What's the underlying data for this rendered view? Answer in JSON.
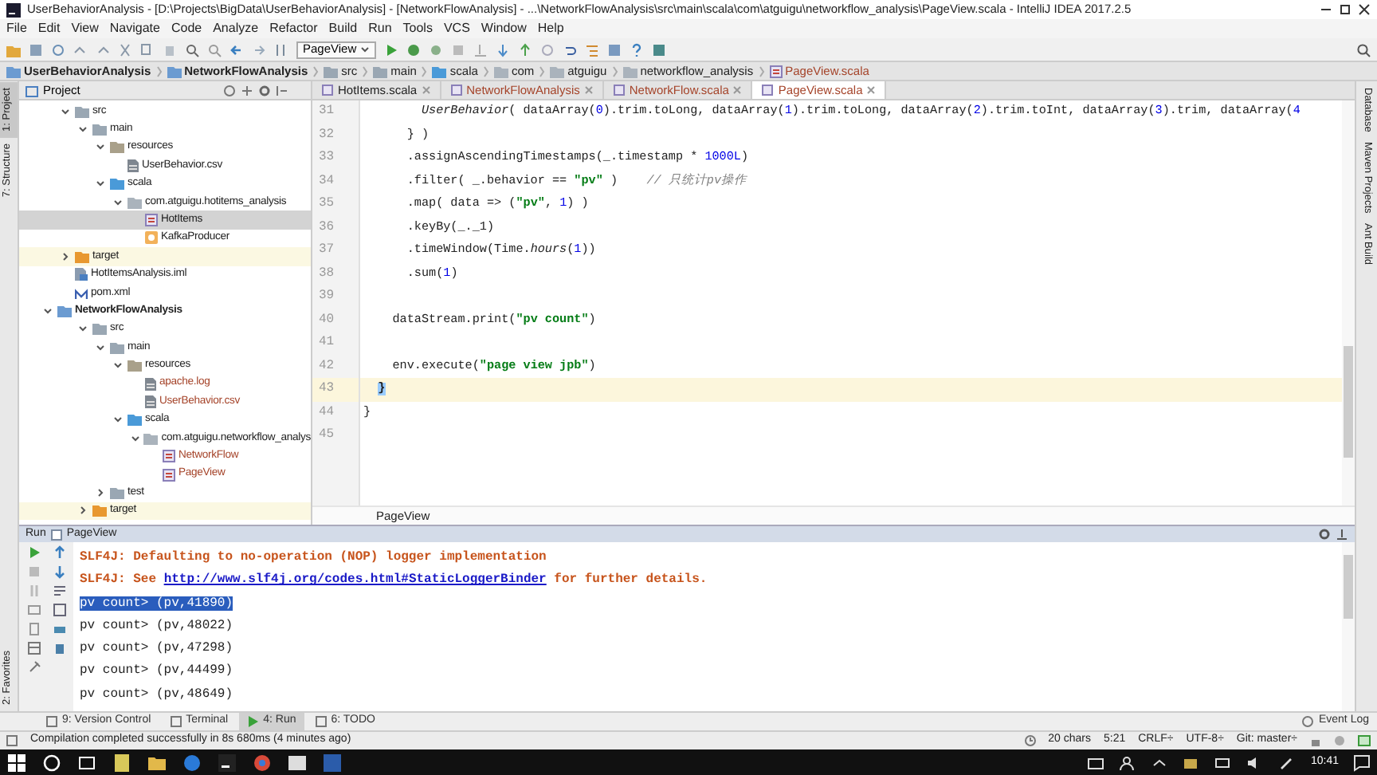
{
  "window": {
    "title": "UserBehaviorAnalysis - [D:\\Projects\\BigData\\UserBehaviorAnalysis] - [NetworkFlowAnalysis] - ...\\NetworkFlowAnalysis\\src\\main\\scala\\com\\atguigu\\networkflow_analysis\\PageView.scala - IntelliJ IDEA 2017.2.5"
  },
  "menu": [
    "File",
    "Edit",
    "View",
    "Navigate",
    "Code",
    "Analyze",
    "Refactor",
    "Build",
    "Run",
    "Tools",
    "VCS",
    "Window",
    "Help"
  ],
  "toolbar": {
    "run_config": "PageView"
  },
  "breadcrumbs": [
    {
      "label": "UserBehaviorAnalysis",
      "kind": "module"
    },
    {
      "label": "NetworkFlowAnalysis",
      "kind": "module"
    },
    {
      "label": "src",
      "kind": "folder"
    },
    {
      "label": "main",
      "kind": "folder"
    },
    {
      "label": "scala",
      "kind": "source-folder"
    },
    {
      "label": "com",
      "kind": "package"
    },
    {
      "label": "atguigu",
      "kind": "package"
    },
    {
      "label": "networkflow_analysis",
      "kind": "package"
    },
    {
      "label": "PageView.scala",
      "kind": "object"
    }
  ],
  "side_tools": {
    "left": [
      {
        "label": "1: Project",
        "selected": true
      },
      {
        "label": "7: Structure",
        "selected": false
      },
      {
        "label": "2: Favorites",
        "selected": false
      }
    ],
    "right": [
      "Database",
      "Maven Projects",
      "Ant Build"
    ]
  },
  "project_panel": {
    "title": "Project",
    "tree": [
      {
        "label": "src",
        "kind": "folder",
        "expanded": true,
        "selected": false,
        "untracked": false,
        "children": [
          {
            "label": "main",
            "kind": "folder",
            "expanded": true,
            "selected": false,
            "untracked": false,
            "children": [
              {
                "label": "resources",
                "kind": "resources-folder",
                "expanded": true,
                "selected": false,
                "untracked": false,
                "children": [
                  {
                    "label": "UserBehavior.csv",
                    "kind": "data-file",
                    "selected": false,
                    "untracked": false
                  }
                ]
              },
              {
                "label": "scala",
                "kind": "source-folder",
                "expanded": true,
                "selected": false,
                "untracked": false,
                "children": [
                  {
                    "label": "com.atguigu.hotitems_analysis",
                    "kind": "package",
                    "expanded": true,
                    "selected": false,
                    "untracked": false,
                    "children": [
                      {
                        "label": "HotItems",
                        "kind": "object",
                        "selected": true,
                        "untracked": false
                      },
                      {
                        "label": "KafkaProducer",
                        "kind": "class",
                        "selected": false,
                        "untracked": false
                      }
                    ]
                  }
                ]
              }
            ]
          }
        ]
      },
      {
        "label": "target",
        "kind": "excluded-folder",
        "expanded": false,
        "selected": false,
        "untracked": false
      },
      {
        "label": "HotItemsAnalysis.iml",
        "kind": "iml-file",
        "selected": false,
        "untracked": false
      },
      {
        "label": "pom.xml",
        "kind": "maven-file",
        "selected": false,
        "untracked": false
      },
      {
        "label": "NetworkFlowAnalysis",
        "kind": "module",
        "expanded": true,
        "selected": false,
        "untracked": false,
        "children": [
          {
            "label": "src",
            "kind": "folder",
            "expanded": true,
            "selected": false,
            "untracked": false,
            "children": [
              {
                "label": "main",
                "kind": "folder",
                "expanded": true,
                "selected": false,
                "untracked": false,
                "children": [
                  {
                    "label": "resources",
                    "kind": "resources-folder",
                    "expanded": true,
                    "selected": false,
                    "untracked": false,
                    "children": [
                      {
                        "label": "apache.log",
                        "kind": "data-file",
                        "selected": false,
                        "untracked": true
                      },
                      {
                        "label": "UserBehavior.csv",
                        "kind": "data-file",
                        "selected": false,
                        "untracked": true
                      }
                    ]
                  },
                  {
                    "label": "scala",
                    "kind": "source-folder",
                    "expanded": true,
                    "selected": false,
                    "untracked": false,
                    "children": [
                      {
                        "label": "com.atguigu.networkflow_analys",
                        "kind": "package",
                        "expanded": true,
                        "selected": false,
                        "untracked": false,
                        "children": [
                          {
                            "label": "NetworkFlow",
                            "kind": "object",
                            "selected": false,
                            "untracked": true
                          },
                          {
                            "label": "PageView",
                            "kind": "object",
                            "selected": false,
                            "untracked": true
                          }
                        ]
                      }
                    ]
                  }
                ]
              },
              {
                "label": "test",
                "kind": "folder",
                "expanded": false,
                "selected": false,
                "untracked": false
              }
            ]
          },
          {
            "label": "target",
            "kind": "excluded-folder",
            "expanded": false,
            "selected": false,
            "untracked": false
          }
        ]
      }
    ]
  },
  "editor": {
    "tabs": [
      {
        "label": "HotItems.scala",
        "selected": false,
        "untracked": false
      },
      {
        "label": "NetworkFlowAnalysis",
        "selected": false,
        "untracked": true
      },
      {
        "label": "NetworkFlow.scala",
        "selected": false,
        "untracked": true
      },
      {
        "label": "PageView.scala",
        "selected": true,
        "untracked": true
      }
    ],
    "lines": [
      {
        "number": "31",
        "current": false,
        "tokens": [
          {
            "kind": "italic",
            "text": "        UserBehavior"
          },
          {
            "kind": "plain",
            "text": "( dataArray("
          },
          {
            "kind": "number",
            "text": "0"
          },
          {
            "kind": "plain",
            "text": ").trim.toLong, dataArray("
          },
          {
            "kind": "number",
            "text": "1"
          },
          {
            "kind": "plain",
            "text": ").trim.toLong, dataArray("
          },
          {
            "kind": "number",
            "text": "2"
          },
          {
            "kind": "plain",
            "text": ").trim.toInt, dataArray("
          },
          {
            "kind": "number",
            "text": "3"
          },
          {
            "kind": "plain",
            "text": ").trim, dataArray("
          },
          {
            "kind": "number",
            "text": "4"
          }
        ]
      },
      {
        "number": "32",
        "current": false,
        "tokens": [
          {
            "kind": "plain",
            "text": "      } )"
          }
        ]
      },
      {
        "number": "33",
        "current": false,
        "tokens": [
          {
            "kind": "plain",
            "text": "      .assignAscendingTimestamps(_.timestamp * "
          },
          {
            "kind": "number",
            "text": "1000L"
          },
          {
            "kind": "plain",
            "text": ")"
          }
        ]
      },
      {
        "number": "34",
        "current": false,
        "tokens": [
          {
            "kind": "plain",
            "text": "      .filter( _.behavior == "
          },
          {
            "kind": "string",
            "text": "\"pv\""
          },
          {
            "kind": "plain",
            "text": " )    "
          },
          {
            "kind": "comment",
            "text": "// 只统计pv操作"
          }
        ]
      },
      {
        "number": "35",
        "current": false,
        "tokens": [
          {
            "kind": "plain",
            "text": "      .map( data => ("
          },
          {
            "kind": "string",
            "text": "\"pv\""
          },
          {
            "kind": "plain",
            "text": ", "
          },
          {
            "kind": "number",
            "text": "1"
          },
          {
            "kind": "plain",
            "text": ") )"
          }
        ]
      },
      {
        "number": "36",
        "current": false,
        "tokens": [
          {
            "kind": "plain",
            "text": "      .keyBy(_._1)"
          }
        ]
      },
      {
        "number": "37",
        "current": false,
        "tokens": [
          {
            "kind": "plain",
            "text": "      .timeWindow(Time."
          },
          {
            "kind": "italic",
            "text": "hours"
          },
          {
            "kind": "plain",
            "text": "("
          },
          {
            "kind": "number",
            "text": "1"
          },
          {
            "kind": "plain",
            "text": "))"
          }
        ]
      },
      {
        "number": "38",
        "current": false,
        "tokens": [
          {
            "kind": "plain",
            "text": "      .sum("
          },
          {
            "kind": "number",
            "text": "1"
          },
          {
            "kind": "plain",
            "text": ")"
          }
        ]
      },
      {
        "number": "39",
        "current": false
      },
      {
        "number": "40",
        "current": false,
        "tokens": [
          {
            "kind": "plain",
            "text": "    dataStream.print("
          },
          {
            "kind": "string",
            "text": "\"pv count\""
          },
          {
            "kind": "plain",
            "text": ")"
          }
        ]
      },
      {
        "number": "41",
        "current": false
      },
      {
        "number": "42",
        "current": false,
        "tokens": [
          {
            "kind": "plain",
            "text": "    env.execute("
          },
          {
            "kind": "string",
            "text": "\"page view jpb\""
          },
          {
            "kind": "plain",
            "text": ")"
          }
        ]
      },
      {
        "number": "43",
        "current": true,
        "tokens": [
          {
            "kind": "matched",
            "text": "  }"
          }
        ]
      },
      {
        "number": "44",
        "current": false,
        "tokens": [
          {
            "kind": "plain",
            "text": "}"
          }
        ]
      },
      {
        "number": "45",
        "current": false
      }
    ],
    "footer": "PageView"
  },
  "run_panel": {
    "label": "Run",
    "config": "PageView",
    "console": [
      {
        "kind": "warning",
        "text": "SLF4J: Defaulting to no-operation (NOP) logger implementation",
        "selected": false
      },
      {
        "kind": "warning-link",
        "before": "SLF4J: See ",
        "link": "http://www.slf4j.org/codes.html#StaticLoggerBinder",
        "after": " for further details.",
        "selected": false
      },
      {
        "kind": "output",
        "text": "pv count> (pv,41890)",
        "selected": true
      },
      {
        "kind": "output",
        "text": "pv count> (pv,48022)",
        "selected": false
      },
      {
        "kind": "output",
        "text": "pv count> (pv,47298)",
        "selected": false
      },
      {
        "kind": "output",
        "text": "pv count> (pv,44499)",
        "selected": false
      },
      {
        "kind": "output",
        "text": "pv count> (pv,48649)",
        "selected": false
      }
    ]
  },
  "tool_tabs": [
    {
      "label": "9: Version Control",
      "selected": false
    },
    {
      "label": "Terminal",
      "selected": false
    },
    {
      "label": "4: Run",
      "selected": true
    },
    {
      "label": "6: TODO",
      "selected": false
    }
  ],
  "event_log": "Event Log",
  "status_bar": {
    "message": "Compilation completed successfully in 8s 680ms (4 minutes ago)",
    "items": [
      "20 chars",
      "5:21",
      "CRLF÷",
      "UTF-8÷",
      "Git: master÷"
    ]
  },
  "taskbar": {
    "time": "10:41"
  }
}
